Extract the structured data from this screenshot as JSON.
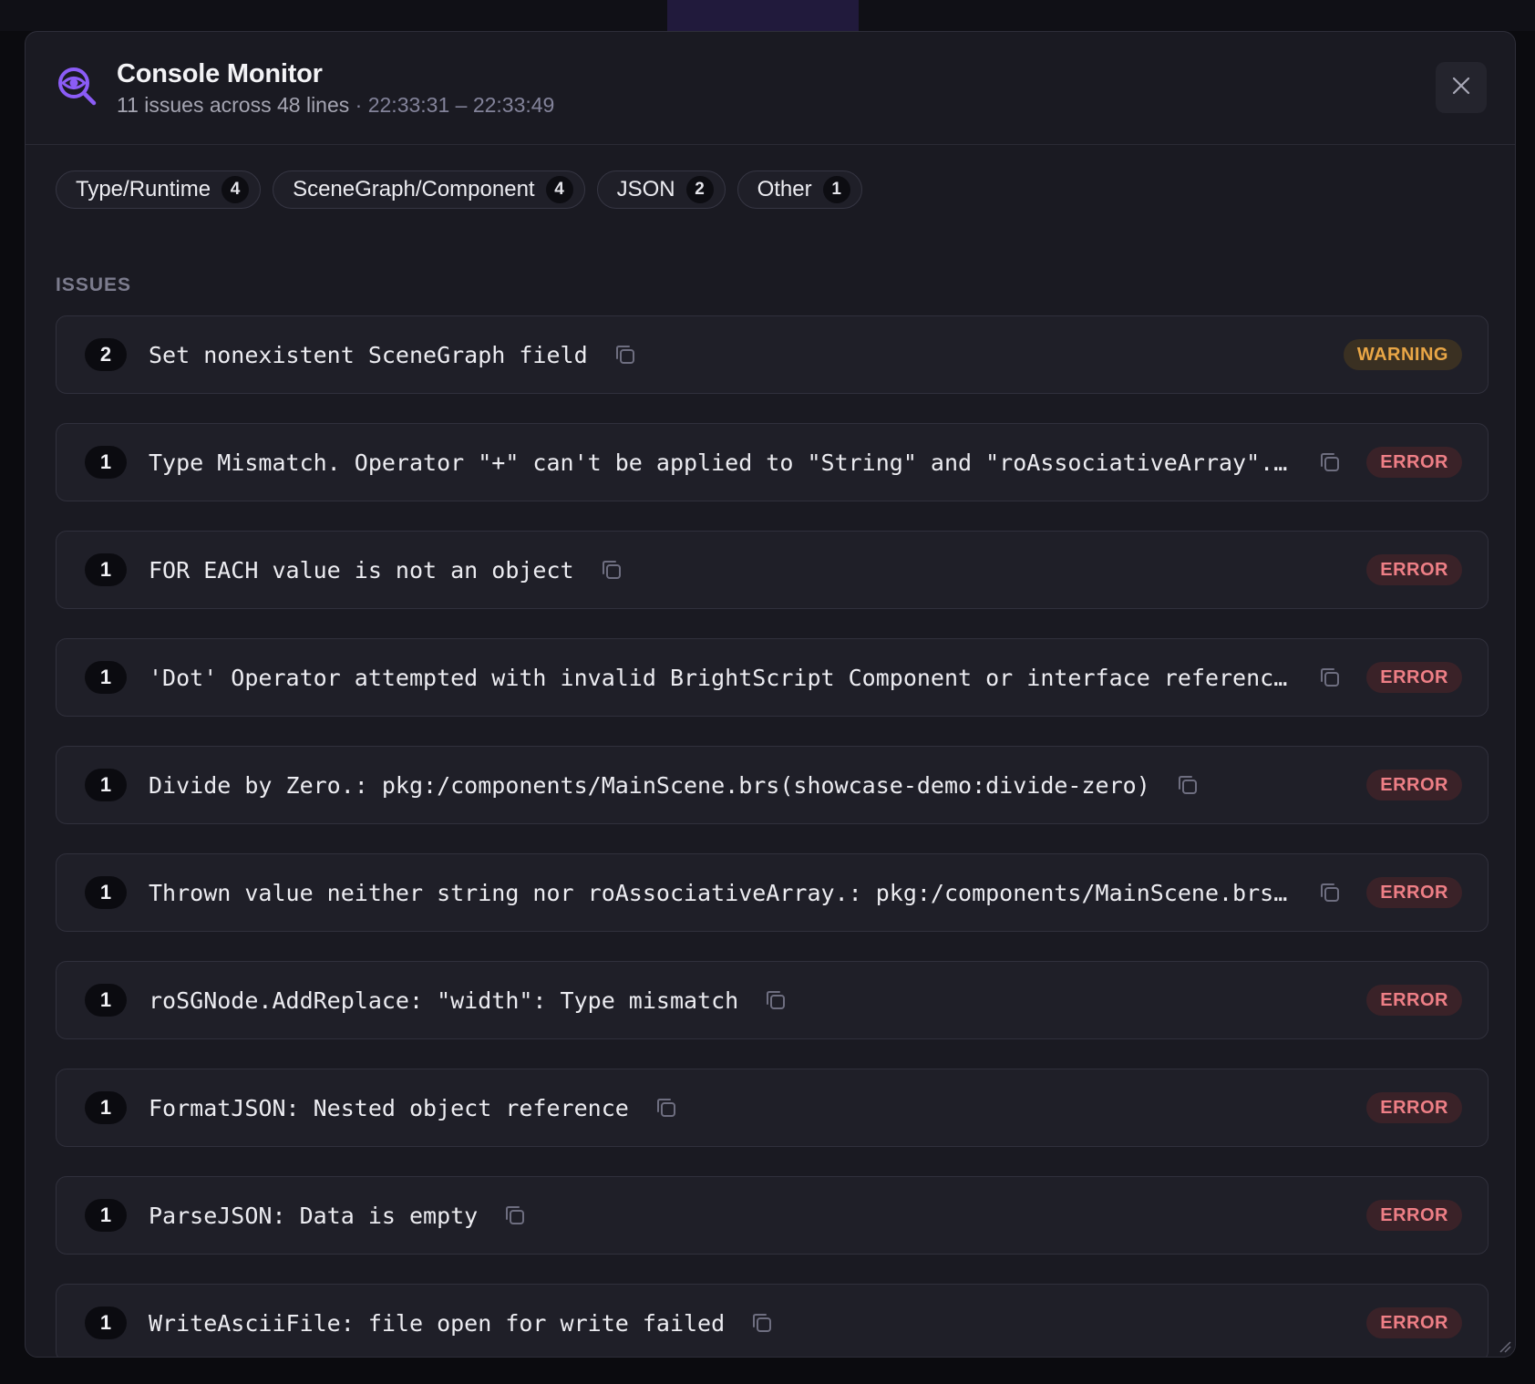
{
  "dialog": {
    "title": "Console Monitor",
    "summary": "11 issues across 48 lines",
    "separator": "·",
    "time_range": "22:33:31 – 22:33:49"
  },
  "filters": [
    {
      "label": "Type/Runtime",
      "count": "4"
    },
    {
      "label": "SceneGraph/Component",
      "count": "4"
    },
    {
      "label": "JSON",
      "count": "2"
    },
    {
      "label": "Other",
      "count": "1"
    }
  ],
  "issues_label": "ISSUES",
  "issues": [
    {
      "count": "2",
      "message": "Set nonexistent SceneGraph field",
      "severity": "WARNING",
      "level": "warning"
    },
    {
      "count": "1",
      "message": "Type Mismatch. Operator \"+\" can't be applied to \"String\" and \"roAssociativeArray\".: pkg:/components/MainScene.brs",
      "severity": "ERROR",
      "level": "error"
    },
    {
      "count": "1",
      "message": "FOR EACH value is not an object",
      "severity": "ERROR",
      "level": "error"
    },
    {
      "count": "1",
      "message": "'Dot' Operator attempted with invalid BrightScript Component or interface reference: pkg:/components/MainScene.brs",
      "severity": "ERROR",
      "level": "error"
    },
    {
      "count": "1",
      "message": "Divide by Zero.: pkg:/components/MainScene.brs(showcase-demo:divide-zero)",
      "severity": "ERROR",
      "level": "error"
    },
    {
      "count": "1",
      "message": "Thrown value neither string nor roAssociativeArray.: pkg:/components/MainScene.brs(showcase-demo)",
      "severity": "ERROR",
      "level": "error"
    },
    {
      "count": "1",
      "message": "roSGNode.AddReplace: \"width\": Type mismatch",
      "severity": "ERROR",
      "level": "error"
    },
    {
      "count": "1",
      "message": "FormatJSON: Nested object reference",
      "severity": "ERROR",
      "level": "error"
    },
    {
      "count": "1",
      "message": "ParseJSON: Data is empty",
      "severity": "ERROR",
      "level": "error"
    },
    {
      "count": "1",
      "message": "WriteAsciiFile: file open for write failed",
      "severity": "ERROR",
      "level": "error"
    }
  ],
  "colors": {
    "accent": "#8b5cf6",
    "error_text": "#ee7f86",
    "warning_text": "#e9a646"
  },
  "icons": {
    "app": "eye-magnifier-icon",
    "close": "close-icon",
    "copy": "copy-icon",
    "resize": "resize-grip-icon"
  }
}
